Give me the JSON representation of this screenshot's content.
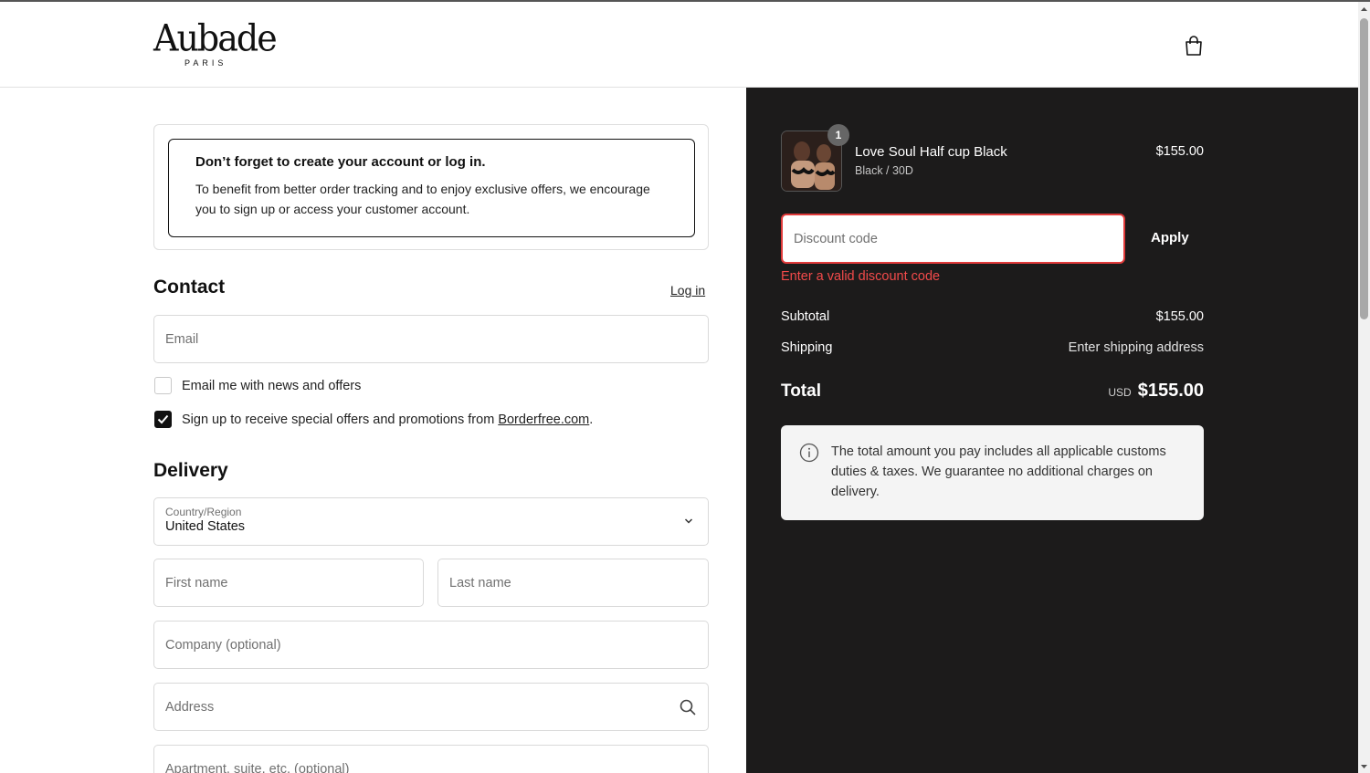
{
  "brand": {
    "name": "Aubade",
    "sub": "PARIS"
  },
  "notice": {
    "title": "Don’t forget to create your account or log in.",
    "body": "To benefit from better order tracking and to enjoy exclusive offers, we encourage you to sign up or access your customer account."
  },
  "contact": {
    "title": "Contact",
    "login_label": "Log in",
    "email_placeholder": "Email",
    "news_label": "Email me with news and offers",
    "news_checked": false,
    "promo_label_prefix": "Sign up to receive special offers and promotions from ",
    "promo_link": "Borderfree.com",
    "promo_label_suffix": ".",
    "promo_checked": true
  },
  "delivery": {
    "title": "Delivery",
    "country_label": "Country/Region",
    "country_value": "United States",
    "first_name_placeholder": "First name",
    "last_name_placeholder": "Last name",
    "company_placeholder": "Company (optional)",
    "address_placeholder": "Address",
    "apartment_placeholder": "Apartment, suite, etc. (optional)"
  },
  "order": {
    "item": {
      "name": "Love Soul Half cup Black",
      "variant": "Black / 30D",
      "price": "$155.00",
      "quantity": "1"
    },
    "discount_placeholder": "Discount code",
    "apply_label": "Apply",
    "discount_error": "Enter a valid discount code",
    "subtotal_label": "Subtotal",
    "subtotal_value": "$155.00",
    "shipping_label": "Shipping",
    "shipping_value": "Enter shipping address",
    "total_label": "Total",
    "total_currency": "USD",
    "total_value": "$155.00",
    "duties_note": "The total amount you pay includes all applicable customs duties & taxes. We guarantee no additional charges on delivery."
  },
  "colors": {
    "summary_bg": "#1c1b1b",
    "error": "#e03a3a",
    "accent": "#111111"
  },
  "icons": [
    "shopping-bag-icon",
    "chevron-down-icon",
    "search-icon",
    "info-icon",
    "checkmark-icon"
  ]
}
